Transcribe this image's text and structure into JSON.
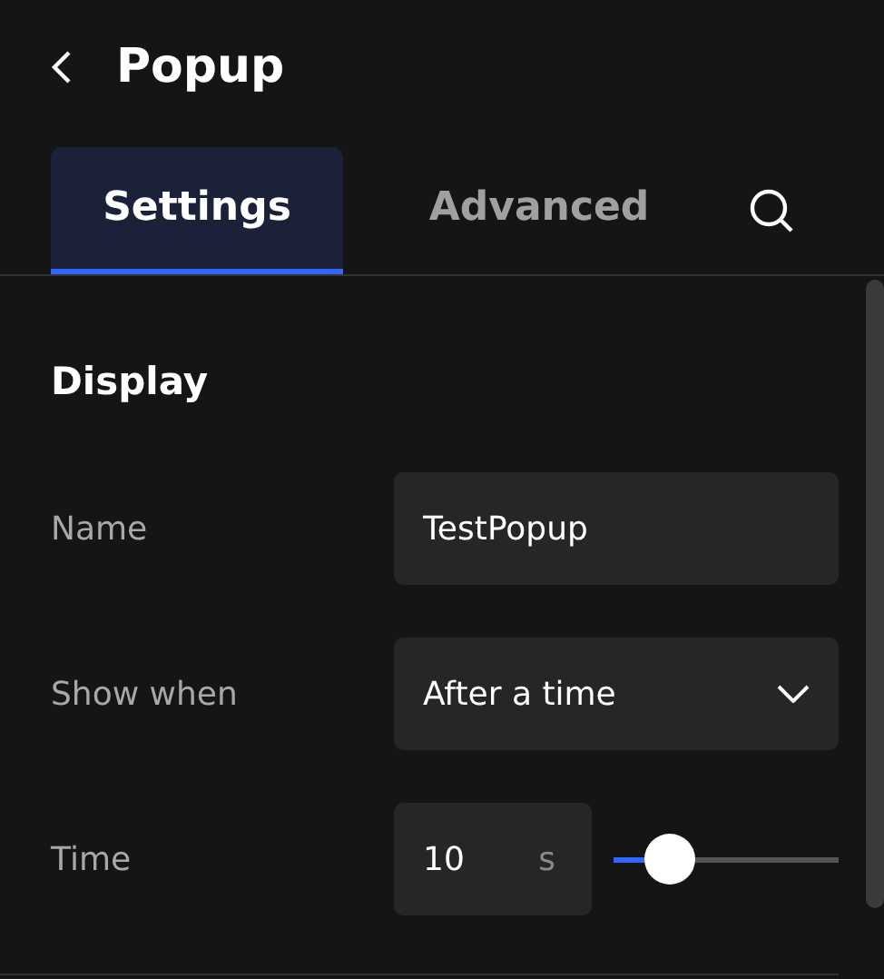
{
  "header": {
    "title": "Popup"
  },
  "tabs": [
    {
      "label": "Settings",
      "selected": true
    },
    {
      "label": "Advanced",
      "selected": false
    }
  ],
  "section": {
    "title": "Display"
  },
  "fields": [
    {
      "kind": "text",
      "label": "Name",
      "value": "TestPopup"
    },
    {
      "kind": "select",
      "label": "Show when",
      "value": "After a time"
    },
    {
      "kind": "number-slider",
      "label": "Time",
      "value": "10",
      "unit": "s",
      "level": 0.18
    }
  ]
}
